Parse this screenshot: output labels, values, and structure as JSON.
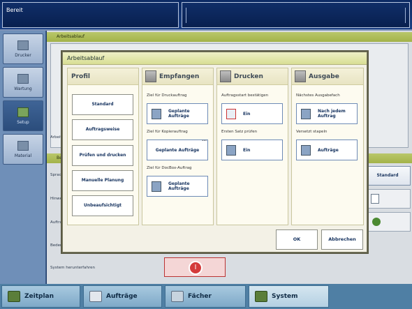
{
  "status": {
    "text": "Bereit"
  },
  "sidebar": {
    "items": [
      {
        "label": "Drucker",
        "icon": "printer-icon"
      },
      {
        "label": "Wartung",
        "icon": "wrench-icon"
      },
      {
        "label": "Setup",
        "icon": "gears-icon"
      },
      {
        "label": "Material",
        "icon": "paper-stack-icon"
      }
    ]
  },
  "background": {
    "header1": "Arbeitsablauf",
    "row_arbeit": "Arbeit",
    "header2": "Be",
    "row_sprac": "Sprac",
    "row_hinwe": "Hinwe",
    "row_auftra": "Auftra",
    "row_beder": "Beder",
    "row_shutdown": "System herunterfahren",
    "standard_btn": "Standard"
  },
  "dialog": {
    "title": "Arbeitsablauf",
    "profile": {
      "header": "Profil",
      "buttons": [
        "Standard",
        "Auftragsweise",
        "Prüfen und drucken",
        "Manuelle Planung",
        "Unbeaufsichtigt"
      ]
    },
    "empfangen": {
      "header": "Empfangen",
      "cap1": "Ziel für Druckauftrag",
      "btn1_l1": "Geplante",
      "btn1_l2": "Aufträge",
      "cap2": "Ziel für Kopierauftrag",
      "btn2": "Geplante Aufträge",
      "cap3": "Ziel für DocBox-Auftrag",
      "btn3_l1": "Geplante",
      "btn3_l2": "Aufträge"
    },
    "drucken": {
      "header": "Drucken",
      "cap1": "Auftragsstart bestätigen",
      "btn1": "Ein",
      "cap2": "Ersten Satz prüfen",
      "btn2": "Ein"
    },
    "ausgabe": {
      "header": "Ausgabe",
      "cap1": "Nächstes Ausgabefach",
      "btn1_l1": "Nach jedem",
      "btn1_l2": "Auftrag",
      "cap2": "Versetzt stapeln",
      "btn2": "Aufträge"
    },
    "ok": "OK",
    "cancel": "Abbrechen"
  },
  "bottom_tabs": [
    {
      "label": "Zeitplan",
      "icon": "schedule-icon"
    },
    {
      "label": "Aufträge",
      "icon": "jobs-icon"
    },
    {
      "label": "Fächer",
      "icon": "trays-icon"
    },
    {
      "label": "System",
      "icon": "system-gears-icon"
    }
  ]
}
